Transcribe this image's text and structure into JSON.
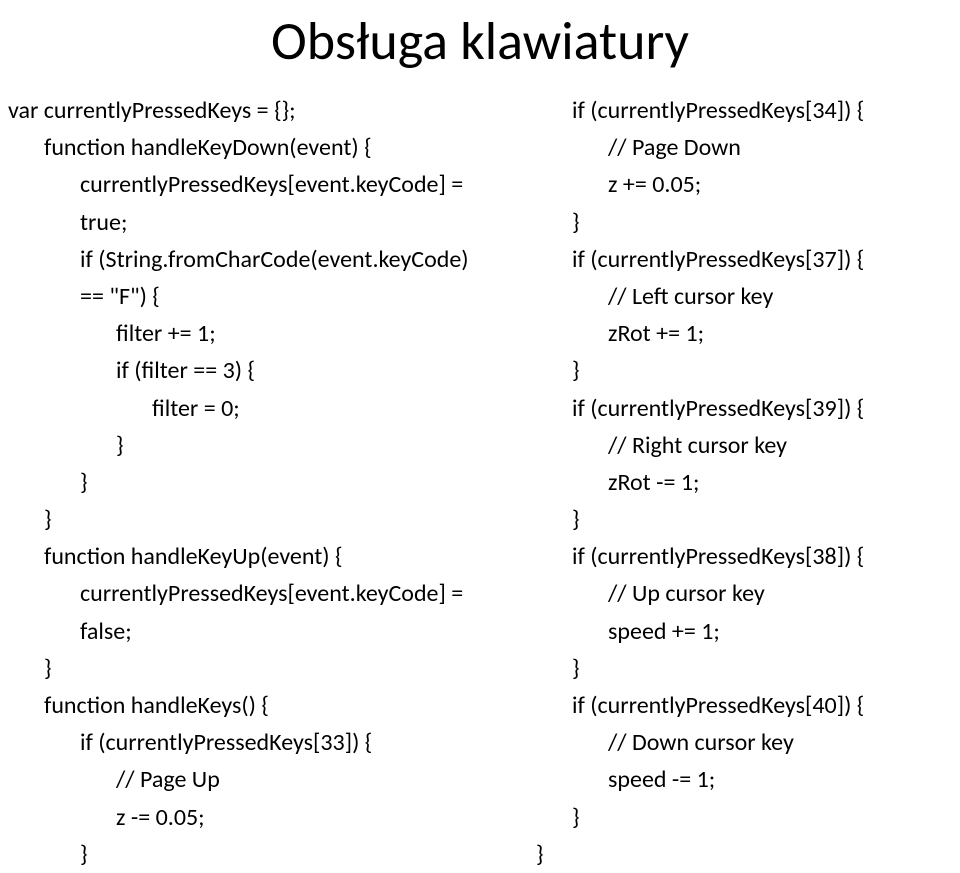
{
  "title": "Obsługa klawiatury",
  "left": {
    "l00": "var currentlyPressedKeys = {};",
    "l01": "function handleKeyDown(event) {",
    "l02": "currentlyPressedKeys[event.keyCode] = true;",
    "l03": "if (String.fromCharCode(event.keyCode) == \"F\") {",
    "l04": "filter += 1;",
    "l05": "if (filter == 3) {",
    "l06": "filter = 0;",
    "l07": "}",
    "l08": "}",
    "l09": "}",
    "l10": "function handleKeyUp(event) {",
    "l11": "currentlyPressedKeys[event.keyCode] = false;",
    "l12": "}",
    "l13": "function handleKeys() {",
    "l14": "if (currentlyPressedKeys[33]) {",
    "l15": "// Page Up",
    "l16": "z -= 0.05;",
    "l17": "}"
  },
  "right": {
    "r00": "if (currentlyPressedKeys[34]) {",
    "r01": "// Page Down",
    "r02": "z += 0.05;",
    "r03": "}",
    "r04": "if (currentlyPressedKeys[37]) {",
    "r05": "// Left cursor key",
    "r06": "zRot += 1;",
    "r07": "}",
    "r08": "if (currentlyPressedKeys[39]) {",
    "r09": "// Right cursor key",
    "r10": "zRot -= 1;",
    "r11": "}",
    "r12": "if (currentlyPressedKeys[38]) {",
    "r13": "// Up cursor key",
    "r14": "speed += 1;",
    "r15": "}",
    "r16": "if (currentlyPressedKeys[40]) {",
    "r17": "// Down cursor key",
    "r18": "speed -= 1;",
    "r19": "}",
    "r20": "}"
  }
}
